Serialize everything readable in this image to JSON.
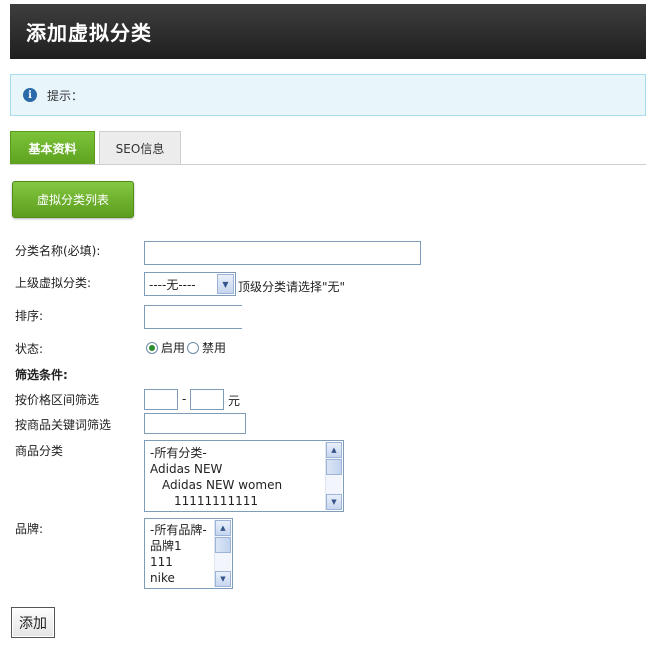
{
  "header": {
    "title": "添加虚拟分类"
  },
  "notice": {
    "icon": "info-icon",
    "text": "提示："
  },
  "tabs": [
    {
      "label": "基本资料",
      "active": true
    },
    {
      "label": "SEO信息",
      "active": false
    }
  ],
  "list_button": {
    "label": "虚拟分类列表"
  },
  "form": {
    "name_label": "分类名称(必填):",
    "name_value": "",
    "parent_label": "上级虚拟分类:",
    "parent_selected": "----无----",
    "parent_hint": "顶级分类请选择\"无\"",
    "sort_label": "排序:",
    "sort_value": "",
    "status_label": "状态:",
    "status_options": [
      {
        "label": "启用",
        "checked": true
      },
      {
        "label": "禁用",
        "checked": false
      }
    ],
    "filter_heading": "筛选条件:",
    "price_label": "按价格区间筛选",
    "price_sep": "-",
    "price_unit": "元",
    "keyword_label": "按商品关键词筛选",
    "category_label": "商品分类",
    "category_options": [
      "-所有分类-",
      "Adidas NEW",
      "Adidas NEW women",
      "11111111111"
    ],
    "brand_label": "品牌:",
    "brand_options": [
      "-所有品牌-",
      "品牌1",
      "111",
      "nike"
    ],
    "submit_label": "添加"
  },
  "colors": {
    "accent_green": "#6ab42a",
    "header_dark": "#2b2b2b",
    "notice_bg": "#e8f6fc"
  }
}
